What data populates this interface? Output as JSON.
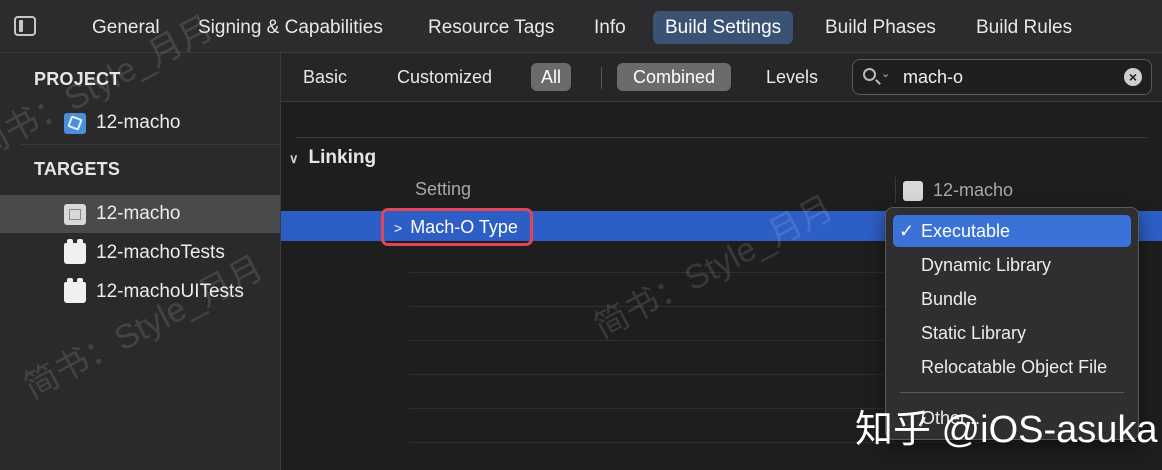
{
  "tabs": [
    "General",
    "Signing & Capabilities",
    "Resource Tags",
    "Info",
    "Build Settings",
    "Build Phases",
    "Build Rules"
  ],
  "active_tab": "Build Settings",
  "sidebar": {
    "project_header": "PROJECT",
    "project_item": "12-macho",
    "targets_header": "TARGETS",
    "targets": [
      "12-macho",
      "12-machoTests",
      "12-machoUITests"
    ]
  },
  "filter": {
    "basic": "Basic",
    "customized": "Customized",
    "all": "All",
    "combined": "Combined",
    "levels": "Levels"
  },
  "search": {
    "value": "mach-o"
  },
  "section": {
    "title": "Linking",
    "col_setting": "Setting",
    "col_target": "12-macho",
    "row_label": "Mach-O Type"
  },
  "menu": {
    "check": "✓",
    "items": [
      "Executable",
      "Dynamic Library",
      "Bundle",
      "Static Library",
      "Relocatable Object File"
    ],
    "other": "Other..."
  },
  "watermarks": {
    "style": "简书：Style_月月",
    "credit": "知乎 @iOS-asuka"
  }
}
